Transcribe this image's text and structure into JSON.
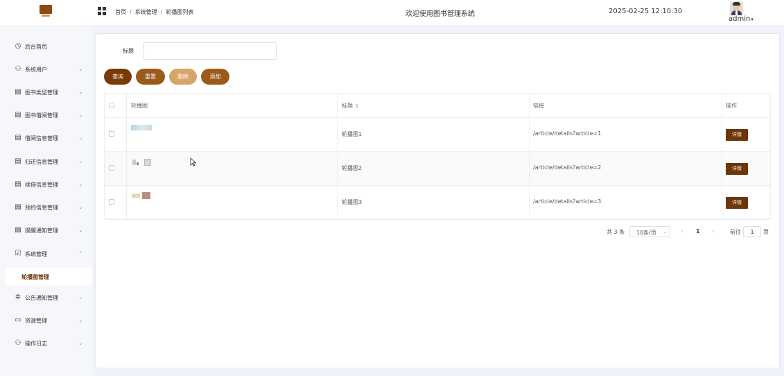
{
  "header": {
    "breadcrumb": [
      "首页",
      "系统管理",
      "轮播图列表"
    ],
    "separator": "/",
    "welcome": "欢迎使用图书管理系统",
    "datetime": "2025-02-25 12:10:30",
    "username": "admin",
    "username_caret": "▾"
  },
  "sidebar": {
    "items": [
      {
        "label": "后台首页",
        "icon": "◷",
        "arrow": ""
      },
      {
        "label": "系统用户",
        "icon": "⚇",
        "arrow": "⌄"
      },
      {
        "label": "图书类型管理",
        "icon": "▤",
        "arrow": "⌄"
      },
      {
        "label": "图书借阅管理",
        "icon": "▤",
        "arrow": "⌄"
      },
      {
        "label": "借阅信息管理",
        "icon": "▤",
        "arrow": "⌄"
      },
      {
        "label": "归还信息管理",
        "icon": "▤",
        "arrow": "⌄"
      },
      {
        "label": "续借信息管理",
        "icon": "▤",
        "arrow": "⌄"
      },
      {
        "label": "预约信息管理",
        "icon": "▤",
        "arrow": "⌄"
      },
      {
        "label": "提醒通知管理",
        "icon": "▤",
        "arrow": "⌄"
      },
      {
        "label": "系统管理",
        "icon": "☑",
        "arrow": "⌃"
      }
    ],
    "active_sub": "轮播图管理",
    "items_after": [
      {
        "label": "公告通知管理",
        "icon": "✲",
        "arrow": "⌄"
      },
      {
        "label": "资源管理",
        "icon": "▭",
        "arrow": "⌄"
      },
      {
        "label": "操作日志",
        "icon": "⚇",
        "arrow": "⌄"
      }
    ]
  },
  "search": {
    "label": "标题",
    "value": "",
    "placeholder": ""
  },
  "buttons": {
    "query": "查询",
    "reset": "重置",
    "delete": "删除",
    "add": "添加"
  },
  "table": {
    "headers": {
      "image": "轮播图",
      "title": "标题",
      "title_sort": "⇕",
      "link": "链接",
      "action": "操作"
    },
    "rows": [
      {
        "title": "轮播图1",
        "link": "/article/details?article=1",
        "action": "详情"
      },
      {
        "title": "轮播图2",
        "link": "/article/details?article=2",
        "action": "详情"
      },
      {
        "title": "轮播图3",
        "link": "/article/details?article=3",
        "action": "详情"
      }
    ]
  },
  "pagination": {
    "total": "共 3 条",
    "page_size": "10条/页",
    "page_size_arrow": "⌄",
    "prev": "‹",
    "current_page": "1",
    "next": "›",
    "goto_label": "前往",
    "goto_value": "1",
    "page_suffix": "页"
  },
  "colors": {
    "brand": "#6b3608",
    "brand_light": "#d8a468",
    "brand_mid": "#9a5a1a"
  }
}
